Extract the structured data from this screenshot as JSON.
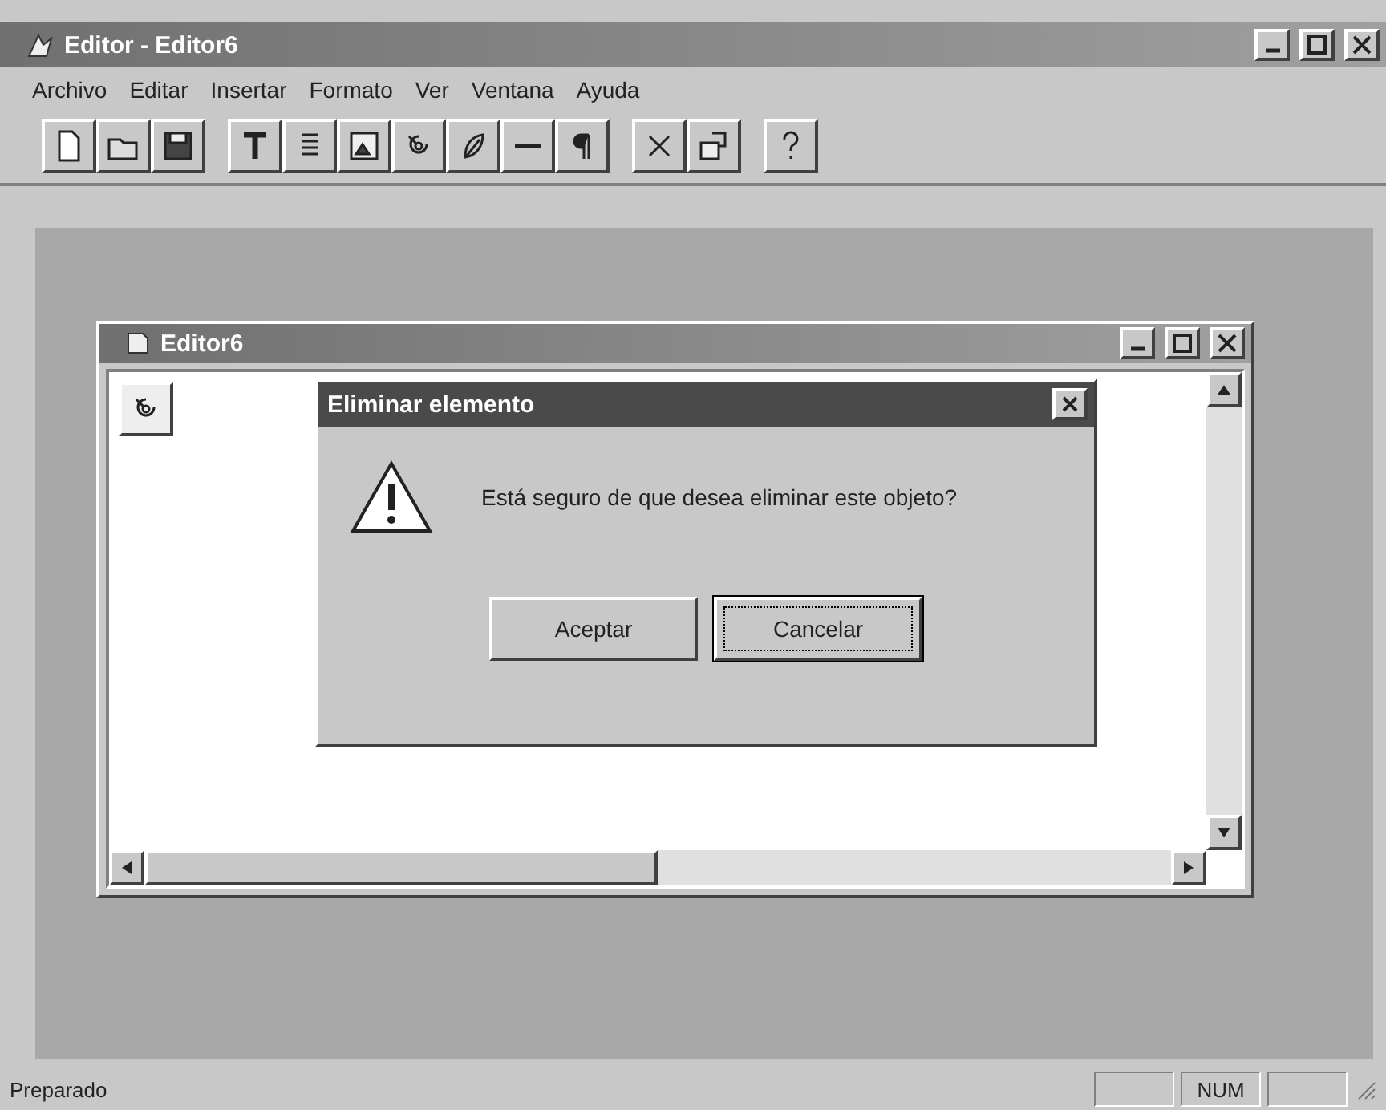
{
  "window": {
    "title": "Editor - Editor6"
  },
  "menu": [
    "Archivo",
    "Editar",
    "Insertar",
    "Formato",
    "Ver",
    "Ventana",
    "Ayuda"
  ],
  "toolbar": [
    {
      "kind": "new"
    },
    {
      "kind": "open"
    },
    {
      "kind": "save"
    },
    {
      "kind": "gap"
    },
    {
      "kind": "text"
    },
    {
      "kind": "list"
    },
    {
      "kind": "image"
    },
    {
      "kind": "sound"
    },
    {
      "kind": "link"
    },
    {
      "kind": "rule"
    },
    {
      "kind": "paragraph"
    },
    {
      "kind": "gap"
    },
    {
      "kind": "delete"
    },
    {
      "kind": "properties"
    },
    {
      "kind": "gap"
    },
    {
      "kind": "help"
    }
  ],
  "child_window": {
    "title": "Editor6"
  },
  "dialog": {
    "title": "Eliminar elemento",
    "message": "Está seguro de que desea eliminar este objeto?",
    "buttons": [
      {
        "label": "Aceptar",
        "selected": false
      },
      {
        "label": "Cancelar",
        "selected": true
      }
    ]
  },
  "status_bar": {
    "text": "Preparado",
    "panels": [
      {
        "kind": "blank"
      },
      {
        "kind": "text",
        "text": "NUM"
      },
      {
        "kind": "blank"
      }
    ]
  }
}
